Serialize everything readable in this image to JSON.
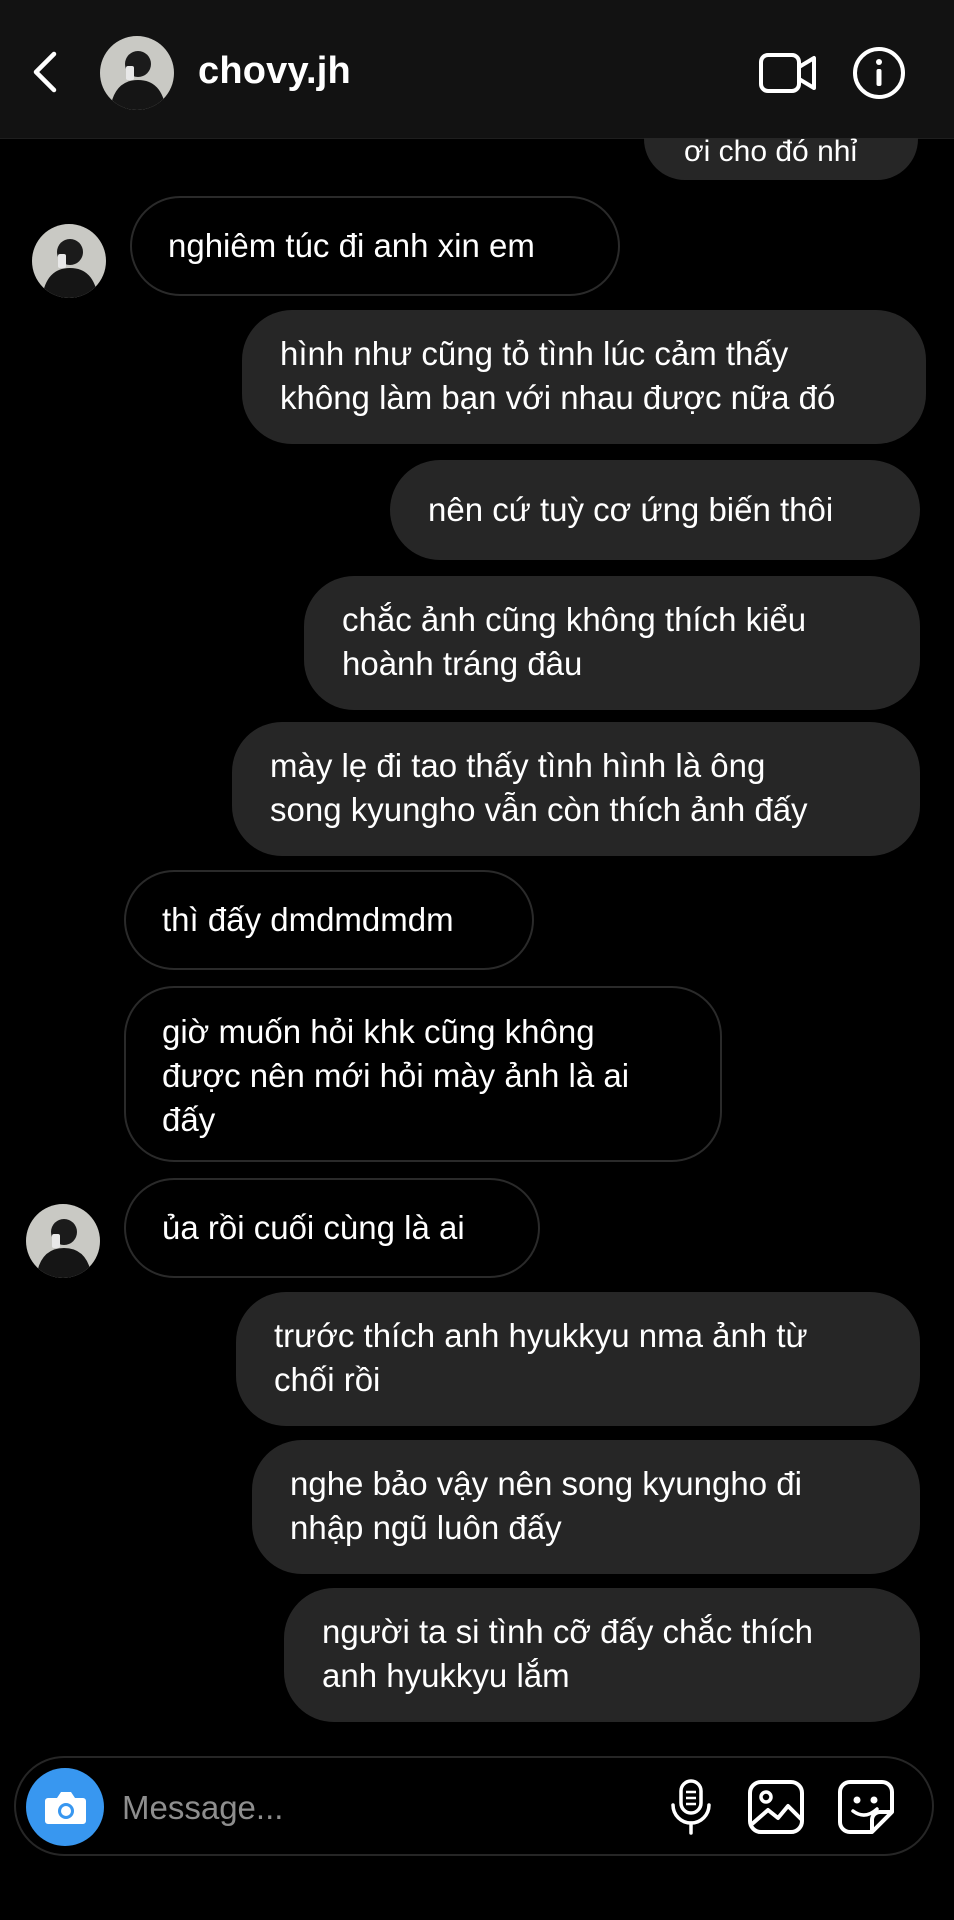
{
  "header": {
    "username": "chovy.jh"
  },
  "thread": {
    "cropped_top_bubble": "ơi cho đó nhỉ",
    "messages": [
      {
        "side": "in",
        "avatar": true,
        "text": "nghiêm túc đi anh xin em"
      },
      {
        "side": "out",
        "avatar": false,
        "text": "hình như cũng tỏ tình lúc cảm thấy\nkhông làm bạn với nhau được nữa đó"
      },
      {
        "side": "out",
        "avatar": false,
        "text": "nên cứ tuỳ cơ ứng biến thôi"
      },
      {
        "side": "out",
        "avatar": false,
        "text": "chắc ảnh cũng không thích kiểu\nhoành tráng đâu"
      },
      {
        "side": "out",
        "avatar": false,
        "text": "mày lẹ đi tao thấy tình hình là ông\nsong kyungho vẫn còn thích ảnh đấy"
      },
      {
        "side": "in",
        "avatar": false,
        "text": "thì đấy dmdmdmdm"
      },
      {
        "side": "in",
        "avatar": false,
        "text": "giờ muốn hỏi khk cũng không\nđược nên mới hỏi mày ảnh là ai\nđấy"
      },
      {
        "side": "in",
        "avatar": true,
        "text": "ủa rồi cuối cùng là ai"
      },
      {
        "side": "out",
        "avatar": false,
        "text": "trước thích anh hyukkyu nma ảnh từ\nchối rồi"
      },
      {
        "side": "out",
        "avatar": false,
        "text": "nghe bảo vậy nên song kyungho đi\nnhập ngũ luôn đấy"
      },
      {
        "side": "out",
        "avatar": false,
        "text": "người ta si tình cỡ đấy chắc thích\nanh hyukkyu lắm"
      }
    ]
  },
  "composer": {
    "placeholder": "Message..."
  },
  "icons": {
    "back": "chevron-left-icon",
    "video": "video-camera-icon",
    "info": "info-icon",
    "camera": "camera-icon",
    "mic": "microphone-icon",
    "gallery": "image-gallery-icon",
    "sticker": "sticker-icon"
  },
  "colors": {
    "background": "#000000",
    "header": "#121212",
    "outgoing_bubble": "#262626",
    "incoming_border": "#2a2a2a",
    "camera_button": "#3897f0",
    "placeholder": "#8e8e8e"
  }
}
